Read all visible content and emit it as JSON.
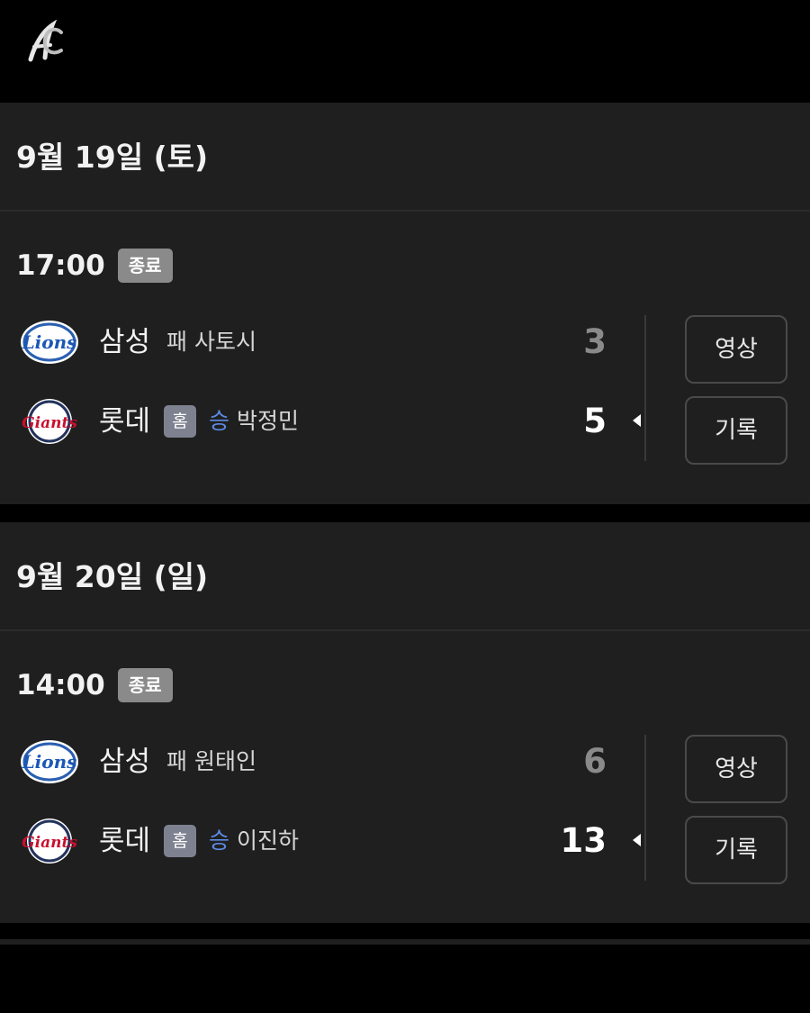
{
  "app": {
    "logo_icon": "team-script-a-logo"
  },
  "colors": {
    "background": "#000000",
    "panel": "#1f1f1f",
    "badge": "#8a8a8a",
    "home_badge": "#7e8290",
    "win_accent": "#5d8be6"
  },
  "days": [
    {
      "date": "9월 19일 (토)",
      "game": {
        "time": "17:00",
        "status": "종료",
        "away": {
          "name": "삼성",
          "result_label": "패",
          "pitcher": "사토시",
          "score": "3",
          "logo_icon": "lions-logo"
        },
        "home": {
          "name": "롯데",
          "home_label": "홈",
          "result_label": "승",
          "pitcher": "박정민",
          "score": "5",
          "logo_icon": "giants-logo"
        },
        "video_button": "영상",
        "record_button": "기록"
      }
    },
    {
      "date": "9월 20일 (일)",
      "game": {
        "time": "14:00",
        "status": "종료",
        "away": {
          "name": "삼성",
          "result_label": "패",
          "pitcher": "원태인",
          "score": "6",
          "logo_icon": "lions-logo"
        },
        "home": {
          "name": "롯데",
          "home_label": "홈",
          "result_label": "승",
          "pitcher": "이진하",
          "score": "13",
          "logo_icon": "giants-logo"
        },
        "video_button": "영상",
        "record_button": "기록"
      }
    }
  ]
}
